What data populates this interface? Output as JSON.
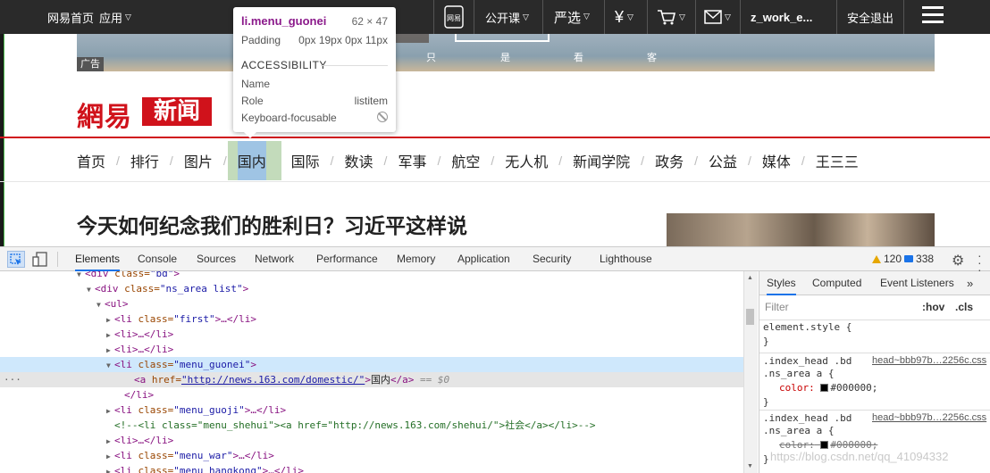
{
  "topbar": {
    "home": "网易首页",
    "apps": "应用",
    "mobile_icon_label": "网易",
    "open_class": "公开课",
    "yanxuan": "严选",
    "user": "z_work_e...",
    "logout": "安全退出"
  },
  "banner": {
    "ad_tag": "广告",
    "chars": [
      "只",
      "是",
      "看",
      "客"
    ]
  },
  "logo": {
    "part1": "網易",
    "part2": "新闻"
  },
  "nav": {
    "items": [
      "首页",
      "排行",
      "图片",
      "国内",
      "国际",
      "数读",
      "军事",
      "航空",
      "无人机",
      "新闻学院",
      "政务",
      "公益",
      "媒体",
      "王三三"
    ],
    "highlighted": "国内"
  },
  "headline": "今天如何纪念我们的胜利日？习近平这样说",
  "tooltip": {
    "selector": "li.menu_guonei",
    "dimensions": "62 × 47",
    "padding_label": "Padding",
    "padding_value": "0px 19px 0px 11px",
    "section": "ACCESSIBILITY",
    "name_label": "Name",
    "role_label": "Role",
    "role_value": "listitem",
    "focus_label": "Keyboard-focusable"
  },
  "devtools": {
    "tabs": [
      "Elements",
      "Console",
      "Sources",
      "Network",
      "Performance",
      "Memory",
      "Application",
      "Security",
      "Lighthouse"
    ],
    "active_tab": "Elements",
    "warnings": "120",
    "messages": "338",
    "dom_lines": [
      {
        "indent": 7,
        "arrow": "▼",
        "open": "<div",
        "attr": " class=",
        "val": "\"bd\"",
        "close": ">"
      },
      {
        "indent": 8,
        "arrow": "▼",
        "open": "<div",
        "attr": " class=",
        "val": "\"ns_area list\"",
        "close": ">"
      },
      {
        "indent": 9,
        "arrow": "▼",
        "open": "<ul>",
        "attr": "",
        "val": "",
        "close": ""
      },
      {
        "indent": 10,
        "arrow": "▶",
        "open": "<li",
        "attr": " class=",
        "val": "\"first\"",
        "close": ">…</li>"
      },
      {
        "indent": 10,
        "arrow": "▶",
        "open": "<li>",
        "attr": "",
        "val": "",
        "close": "…</li>"
      },
      {
        "indent": 10,
        "arrow": "▶",
        "open": "<li>",
        "attr": "",
        "val": "",
        "close": "…</li>"
      },
      {
        "indent": 10,
        "arrow": "▼",
        "open": "<li",
        "attr": " class=",
        "val": "\"menu_guonei\"",
        "close": ">"
      },
      {
        "indent": 12,
        "arrow": "",
        "open": "<a",
        "attr": " href=",
        "val": "\"http://news.163.com/domestic/\"",
        "close": ">",
        "text": "国内",
        "end": "</a>",
        "eq": " == $0"
      },
      {
        "indent": 11,
        "arrow": "",
        "open": "</li>",
        "attr": "",
        "val": "",
        "close": ""
      },
      {
        "indent": 10,
        "arrow": "▶",
        "open": "<li",
        "attr": " class=",
        "val": "\"menu_guoji\"",
        "close": ">…</li>"
      },
      {
        "indent": 10,
        "arrow": "",
        "comment": "<!--<li class=\"menu_shehui\"><a href=\"http://news.163.com/shehui/\">社会</a></li>-->"
      },
      {
        "indent": 10,
        "arrow": "▶",
        "open": "<li>",
        "attr": "",
        "val": "",
        "close": "…</li>"
      },
      {
        "indent": 10,
        "arrow": "▶",
        "open": "<li",
        "attr": " class=",
        "val": "\"menu_war\"",
        "close": ">…</li>"
      },
      {
        "indent": 10,
        "arrow": "▶",
        "open": "<li",
        "attr": " class=",
        "val": "\"menu_hangkong\"",
        "close": ">…</li>"
      }
    ],
    "styles_tabs": [
      "Styles",
      "Computed",
      "Event Listeners"
    ],
    "filter_placeholder": "Filter",
    "hov": ":hov",
    "cls": ".cls",
    "element_style": "element.style {",
    "close_brace": "}",
    "rules": [
      {
        "selector1": ".index_head .bd",
        "selector2": ".ns_area a {",
        "source": "head~bbb97b…2256c.css",
        "prop": "color:",
        "value": "#000000;",
        "struck": false
      },
      {
        "selector1": ".index_head .bd",
        "selector2": ".ns_area a {",
        "source": "head~bbb97b…2256c.css",
        "prop": "color:",
        "value": "#000000;",
        "struck": true
      }
    ],
    "watermark": "https://blog.csdn.net/qq_41094332"
  }
}
